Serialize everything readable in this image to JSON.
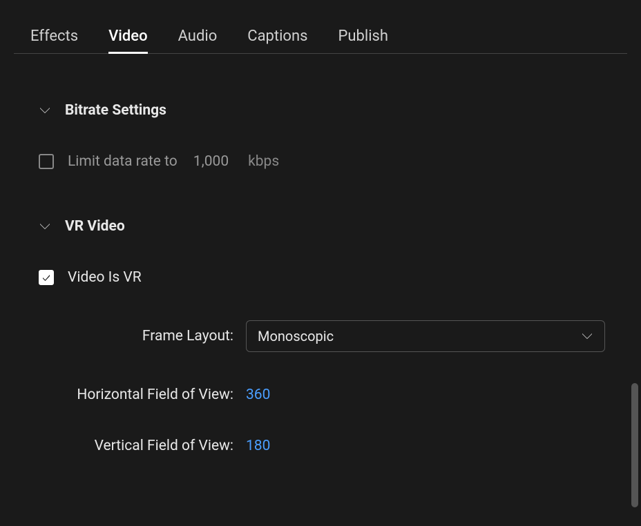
{
  "tabs": [
    {
      "label": "Effects",
      "active": false
    },
    {
      "label": "Video",
      "active": true
    },
    {
      "label": "Audio",
      "active": false
    },
    {
      "label": "Captions",
      "active": false
    },
    {
      "label": "Publish",
      "active": false
    }
  ],
  "sections": {
    "bitrate": {
      "title": "Bitrate Settings",
      "limit_label": "Limit data rate to",
      "limit_value": "1,000",
      "limit_unit": "kbps",
      "limit_checked": false
    },
    "vr": {
      "title": "VR Video",
      "is_vr_label": "Video Is VR",
      "is_vr_checked": true,
      "frame_layout_label": "Frame Layout:",
      "frame_layout_value": "Monoscopic",
      "hfov_label": "Horizontal Field of View:",
      "hfov_value": "360",
      "vfov_label": "Vertical Field of View:",
      "vfov_value": "180"
    }
  }
}
